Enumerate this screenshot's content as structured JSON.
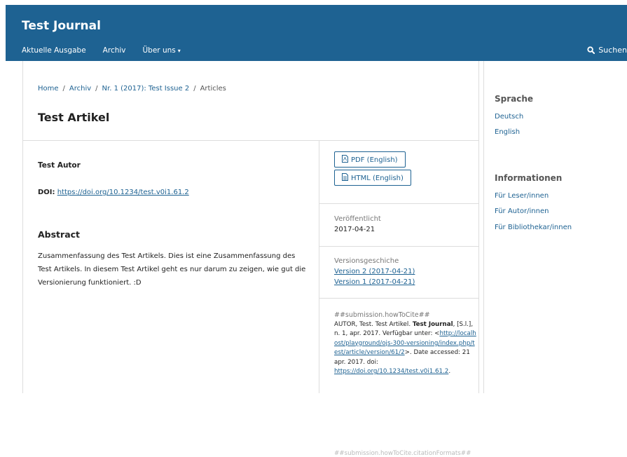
{
  "header": {
    "site_title": "Test Journal",
    "nav": [
      "Aktuelle Ausgabe",
      "Archiv",
      "Über uns"
    ],
    "search_label": "Suchen"
  },
  "breadcrumb": {
    "home": "Home",
    "archive": "Archiv",
    "issue": "Nr. 1 (2017): Test Issue 2",
    "current": "Articles"
  },
  "article": {
    "title": "Test Artikel",
    "author": "Test Autor",
    "doi_label": "DOI:",
    "doi_link": "https://doi.org/10.1234/test.v0i1.61.2",
    "abstract_heading": "Abstract",
    "abstract_text": "Zusammenfassung des Test Artikels. Dies ist eine Zusammenfassung des Test Artikels. In diesem Test Artikel geht es nur darum zu zeigen, wie gut die Versionierung funktioniert. :D"
  },
  "side": {
    "galley_pdf": "PDF (English)",
    "galley_html": "HTML (English)",
    "published_label": "Veröffentlicht",
    "published_date": "2017-04-21",
    "history_label": "Versionsgeschiche",
    "versions": [
      "Version 2 (2017-04-21)",
      "Version 1 (2017-04-21)"
    ],
    "cite_label": "##submission.howToCite##",
    "cite_text_1": "AUTOR, Test. Test Artikel.",
    "cite_journal": "Test Journal",
    "cite_text_2": ", [S.l.], n. 1, apr. 2017. Verfügbar unter: <",
    "cite_url": "http://localhost/playground/ojs-300-versioning/index.php/test/article/version/61/2",
    "cite_text_3": ">. Date accessed: 21 apr. 2017. doi:",
    "cite_doi": "https://doi.org/10.1234/test.v0i1.61.2",
    "cite_text_4": ".",
    "cite_more": "##submission.howToCite.citationFormats##"
  },
  "sidebar": {
    "language_heading": "Sprache",
    "languages": [
      "Deutsch",
      "English"
    ],
    "info_heading": "Informationen",
    "info_links": [
      "Für Leser/innen",
      "Für Autor/innen",
      "Für Bibliothekar/innen"
    ]
  },
  "colors": {
    "brand": "#1e6292",
    "border": "#dddddd"
  },
  "icons": {
    "search": "search-icon",
    "pdf": "pdf-file-icon",
    "html": "html-file-icon"
  }
}
